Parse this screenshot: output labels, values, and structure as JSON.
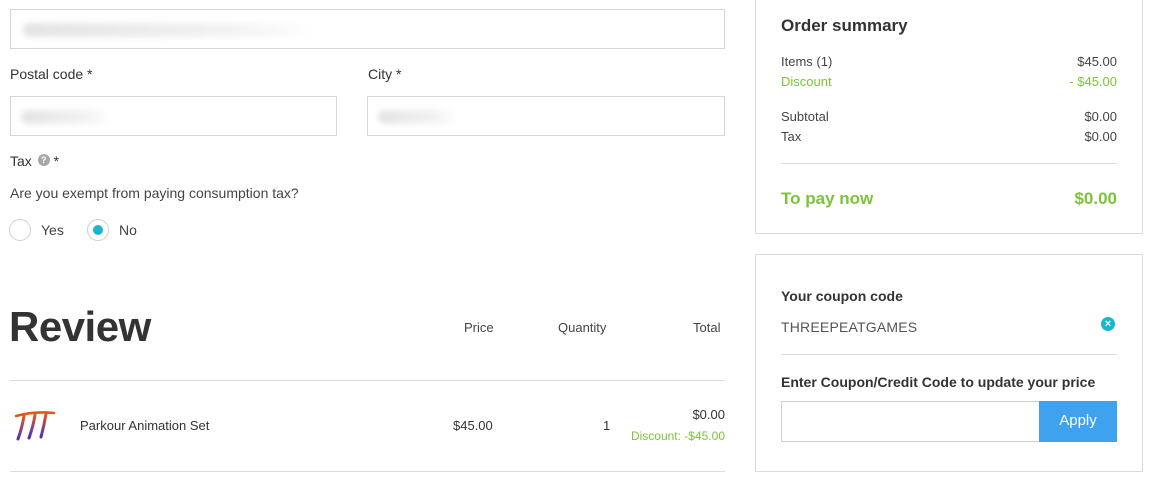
{
  "address_form": {
    "postal_code_label": "Postal code *",
    "city_label": "City *",
    "tax_label": "Tax",
    "tax_required": "*",
    "tax_help_icon": "question-mark-icon",
    "tax_question": "Are you exempt from paying consumption tax?",
    "tax_options": [
      {
        "label": "Yes",
        "selected": false
      },
      {
        "label": "No",
        "selected": true
      }
    ]
  },
  "review": {
    "title": "Review",
    "columns": {
      "price": "Price",
      "quantity": "Quantity",
      "total": "Total"
    },
    "items": [
      {
        "name": "Parkour Animation Set",
        "price": "$45.00",
        "quantity": "1",
        "total": "$0.00",
        "discount": "Discount: -$45.00"
      }
    ]
  },
  "order_summary": {
    "title": "Order summary",
    "items_label": "Items (1)",
    "items_value": "$45.00",
    "discount_label": "Discount",
    "discount_value": "- $45.00",
    "subtotal_label": "Subtotal",
    "subtotal_value": "$0.00",
    "tax_label": "Tax",
    "tax_value": "$0.00",
    "pay_label": "To pay now",
    "pay_value": "$0.00"
  },
  "coupon": {
    "applied_heading": "Your coupon code",
    "applied_code": "THREEPEATGAMES",
    "enter_heading": "Enter Coupon/Credit Code to update your price",
    "input_value": "",
    "input_placeholder": "",
    "apply_label": "Apply"
  },
  "colors": {
    "accent_green": "#7cc33a",
    "radio_teal": "#19b7cf",
    "apply_blue": "#3ea2ee"
  }
}
